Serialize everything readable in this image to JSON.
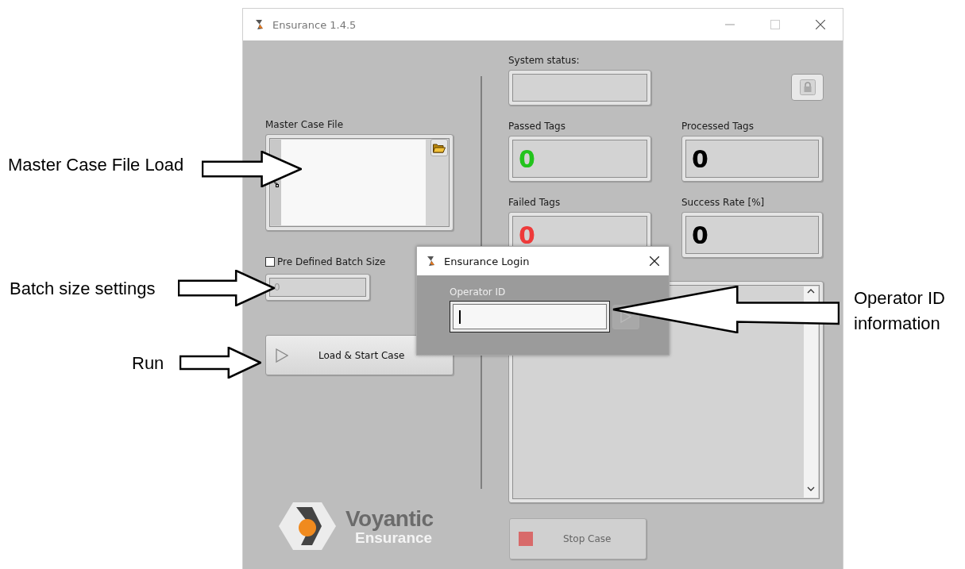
{
  "window": {
    "title": "Ensurance 1.4.5"
  },
  "left": {
    "master_case_file": {
      "label": "Master Case File"
    },
    "batch": {
      "label": "Pre Defined Batch Size",
      "checked": false,
      "value": "0",
      "disabled": true
    },
    "run_button": {
      "label": "Load & Start Case"
    },
    "logo": {
      "name": "Voyantic",
      "product": "Ensurance"
    }
  },
  "right": {
    "system_status": {
      "label": "System status:"
    },
    "counters": [
      {
        "label": "Passed Tags",
        "value": "0",
        "color": "#22c31c"
      },
      {
        "label": "Processed Tags",
        "value": "0",
        "color": "#000000"
      },
      {
        "label": "Failed Tags",
        "value": "0",
        "color": "#ee3a3a"
      },
      {
        "label": "Success Rate [%]",
        "value": "0",
        "color": "#000000"
      }
    ],
    "stop_button": {
      "label": "Stop Case",
      "disabled": true
    }
  },
  "dialog": {
    "title": "Ensurance Login",
    "field_label": "Operator ID"
  },
  "annotations": [
    {
      "text": "Master Case File Load",
      "kind": "rightward"
    },
    {
      "text": "Batch size settings",
      "kind": "rightward"
    },
    {
      "text": "Run",
      "kind": "rightward"
    },
    {
      "text": "Operator ID information",
      "kind": "leftward"
    }
  ]
}
